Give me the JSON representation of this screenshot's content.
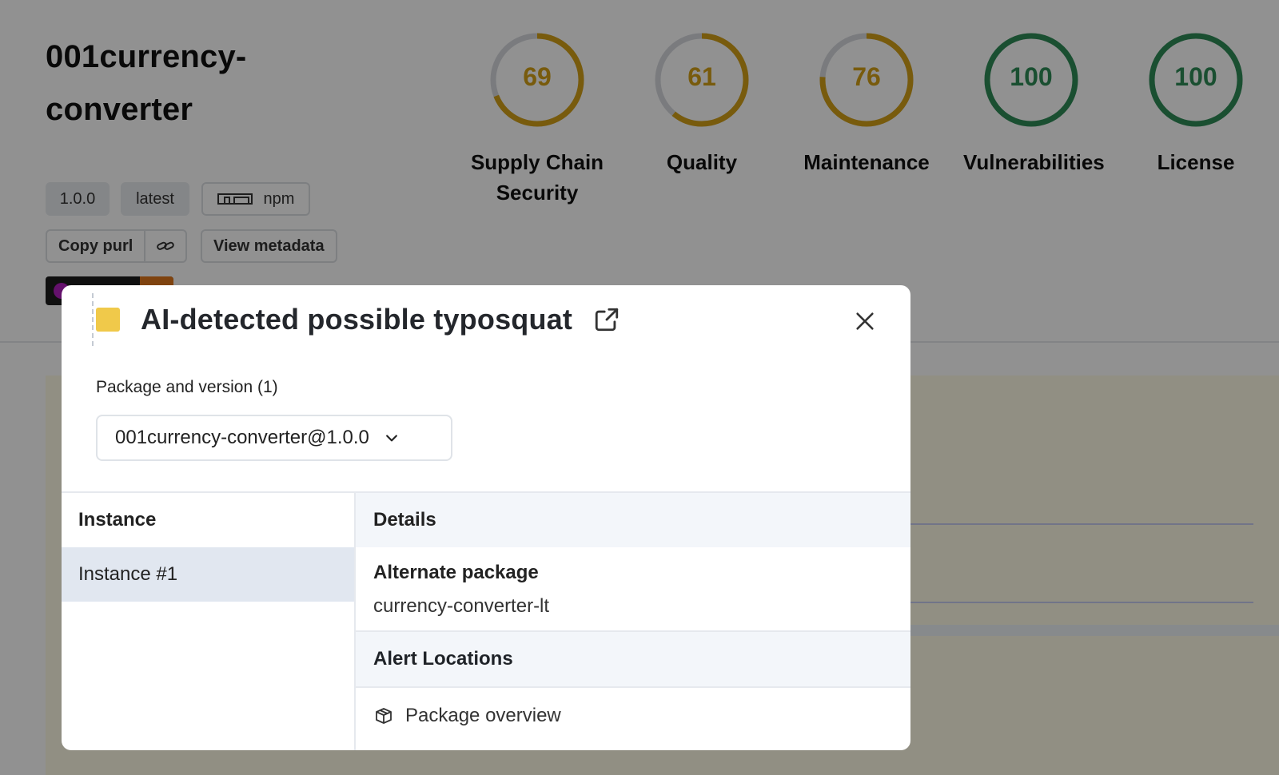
{
  "package": {
    "name": "001currency-converter",
    "version": "1.0.0",
    "tag": "latest",
    "ecosystem": "npm",
    "copy_purl_label": "Copy purl",
    "view_metadata_label": "View metadata"
  },
  "scores": [
    {
      "label": "Supply Chain Security",
      "value": 69,
      "color": "#d4a017"
    },
    {
      "label": "Quality",
      "value": 61,
      "color": "#d4a017"
    },
    {
      "label": "Maintenance",
      "value": 76,
      "color": "#d4a017"
    },
    {
      "label": "Vulnerabilities",
      "value": 100,
      "color": "#2e8b57"
    },
    {
      "label": "License",
      "value": 100,
      "color": "#2e8b57"
    }
  ],
  "modal": {
    "title": "AI-detected possible typosquat",
    "severity_color": "#f0c94a",
    "package_version_label": "Package and version  (1)",
    "selected_package": "001currency-converter@1.0.0",
    "instance_header": "Instance",
    "details_header": "Details",
    "instances": [
      "Instance #1"
    ],
    "details": {
      "alternate_package_label": "Alternate package",
      "alternate_package_value": "currency-converter-lt",
      "alert_locations_label": "Alert Locations",
      "locations": [
        "Package overview"
      ]
    }
  },
  "icons": {
    "external_link": "external-link-icon",
    "close": "close-icon",
    "chevron": "chevron-down-icon",
    "link": "link-icon",
    "box": "box-icon"
  }
}
